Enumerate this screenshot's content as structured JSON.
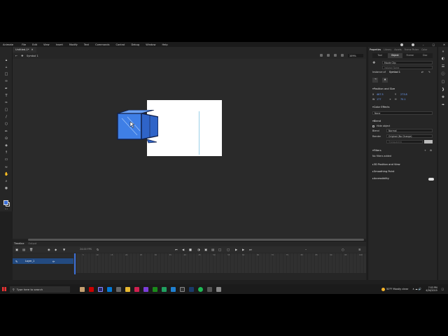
{
  "app": {
    "name": "Animate",
    "menu": [
      "File",
      "Edit",
      "View",
      "Insert",
      "Modify",
      "Text",
      "Commands",
      "Control",
      "Debug",
      "Window",
      "Help"
    ],
    "document_tab": "Untitled-1*",
    "scene": "Symbol 1",
    "zoom": "109%"
  },
  "timeline": {
    "tabs": [
      "Timeline",
      "Output"
    ],
    "fps": "24.00 FPS",
    "frame_numbers": [
      "5",
      "10",
      "15",
      "20",
      "25",
      "30",
      "35",
      "40",
      "45",
      "50",
      "55",
      "60",
      "65",
      "70",
      "75",
      "80",
      "85",
      "90",
      "95",
      "100"
    ],
    "layer_name": "Layer_1"
  },
  "properties": {
    "panel_tabs": [
      "Properties",
      "Library",
      "Assets",
      "Frame Picker",
      "Color"
    ],
    "sub_tabs": [
      "Tool",
      "Object",
      "Frame",
      "Doc"
    ],
    "symbol_type": "Movie Clip",
    "instance_placeholder": "Instance Name",
    "instance_of_label": "Instance of",
    "instance_of": "Symbol 1",
    "position_title": "Position and Size",
    "x_label": "X",
    "x_value": "467.5",
    "y_label": "Y",
    "y_value": "273.8",
    "w_label": "W",
    "w_value": "177",
    "h_label": "H",
    "h_value": "70.1",
    "color_effects_title": "Color Effects",
    "color_effect_value": "None",
    "blend_title": "Blend",
    "hide_object_label": "Hide object",
    "blend_label": "Blend",
    "blend_value": "Normal",
    "render_label": "Render",
    "render_value": "Original (No Change)",
    "transparent_label": "Transparent",
    "filters_title": "Filters",
    "no_filters": "No filters added",
    "three_d_title": "3D Position and View",
    "smoothing_title": "Smoothing Point",
    "accessibility_title": "Accessibility"
  },
  "taskbar": {
    "search_placeholder": "Type here to search",
    "weather": "50°F  Mostly clear",
    "time": "7:53 PM",
    "date": "4/26/2019"
  },
  "colors": {
    "accent": "#3b6fd8",
    "cube_fill": "#3f7fe6",
    "stage": "#ffffff"
  }
}
